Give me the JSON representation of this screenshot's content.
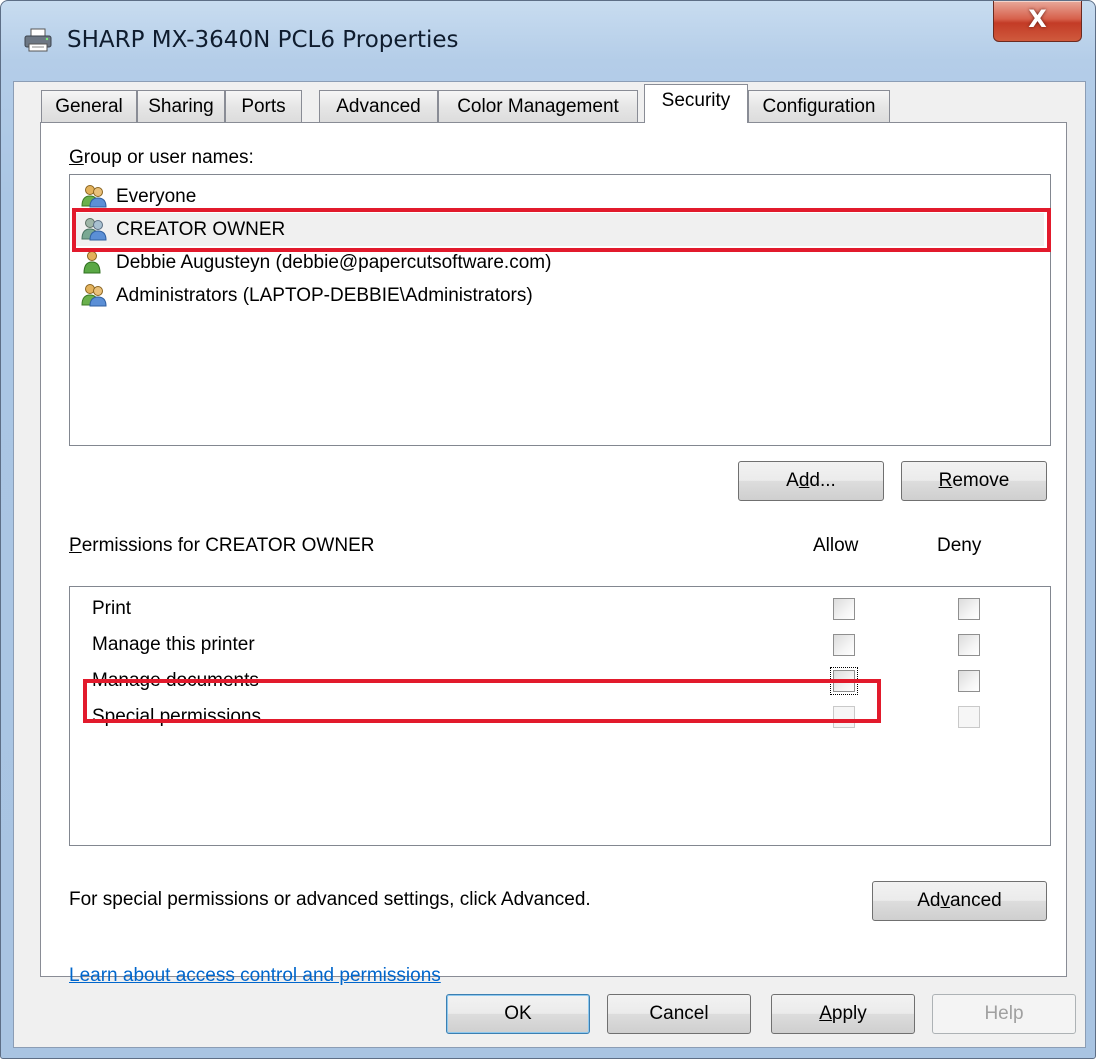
{
  "window": {
    "title": "SHARP MX-3640N PCL6 Properties",
    "close_glyph": "X"
  },
  "tabs": [
    {
      "label": "General"
    },
    {
      "label": "Sharing"
    },
    {
      "label": "Ports"
    },
    {
      "label": "Advanced"
    },
    {
      "label": "Color Management"
    },
    {
      "label": "Security",
      "active": true
    },
    {
      "label": "Configuration"
    }
  ],
  "security": {
    "group_label_underlined": "G",
    "group_label_rest": "roup or user names:",
    "users": [
      {
        "name": "Everyone",
        "icon": "group-users-icon"
      },
      {
        "name": "CREATOR OWNER",
        "icon": "group-users-icon",
        "selected": true
      },
      {
        "name": "Debbie Augusteyn (debbie@papercutsoftware.com)",
        "icon": "single-user-icon"
      },
      {
        "name": "Administrators (LAPTOP-DEBBIE\\Administrators)",
        "icon": "group-users-icon"
      }
    ],
    "add_button": {
      "pre": "A",
      "underlined": "d",
      "post": "d..."
    },
    "remove_button": {
      "pre": "",
      "underlined": "R",
      "post": "emove"
    },
    "permissions_label_underlined": "P",
    "permissions_label_rest": "ermissions for CREATOR OWNER",
    "allow_header": "Allow",
    "deny_header": "Deny",
    "permissions": [
      {
        "name": "Print",
        "allow": false,
        "deny": false,
        "enabled": true
      },
      {
        "name": "Manage this printer",
        "allow": false,
        "deny": false,
        "enabled": true
      },
      {
        "name": "Manage documents",
        "allow": false,
        "deny": false,
        "enabled": true,
        "focused": true
      },
      {
        "name": "Special permissions",
        "allow": false,
        "deny": false,
        "enabled": false
      }
    ],
    "advanced_hint": "For special permissions or advanced settings, click Advanced.",
    "advanced_button": {
      "pre": "Ad",
      "underlined": "v",
      "post": "anced"
    },
    "learn_link": "Learn about access control and permissions"
  },
  "footer": {
    "ok": "OK",
    "cancel": "Cancel",
    "apply": {
      "pre": "",
      "underlined": "A",
      "post": "pply"
    },
    "help": "Help"
  },
  "colors": {
    "highlight": "#e21a2c",
    "link": "#0066cc"
  }
}
